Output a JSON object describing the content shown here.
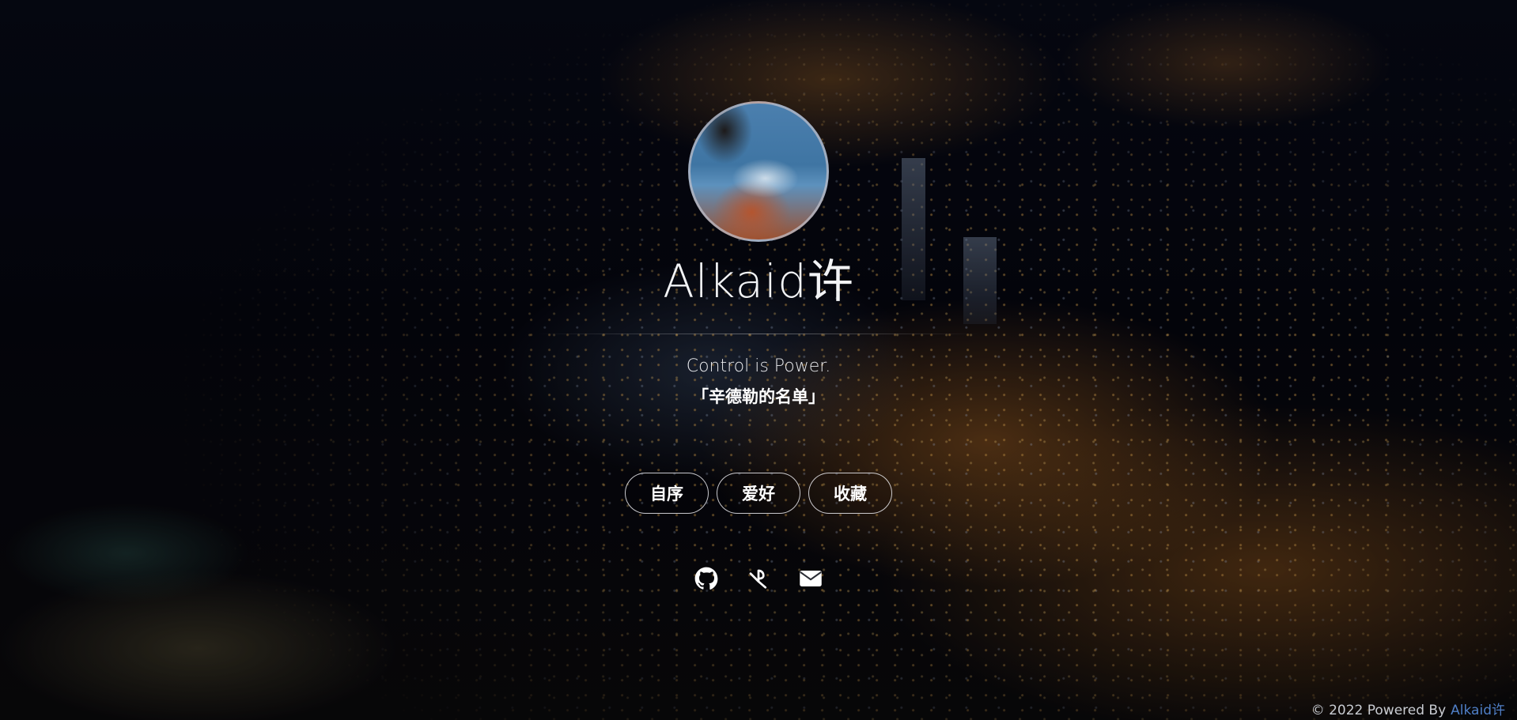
{
  "profile": {
    "name": "Alkaid许",
    "motto": "Control is Power.",
    "quote": "「辛德勒的名单」"
  },
  "nav": {
    "items": [
      {
        "label": "自序"
      },
      {
        "label": "爱好"
      },
      {
        "label": "收藏"
      }
    ]
  },
  "social": {
    "icons": [
      "github-icon",
      "blog-icon",
      "mail-icon"
    ]
  },
  "footer": {
    "copyright": "© 2022 Powered By",
    "author": "Alkaid许"
  },
  "colors": {
    "text": "#ffffff",
    "footer_link": "#4f7fc7",
    "background": "#05060f"
  }
}
